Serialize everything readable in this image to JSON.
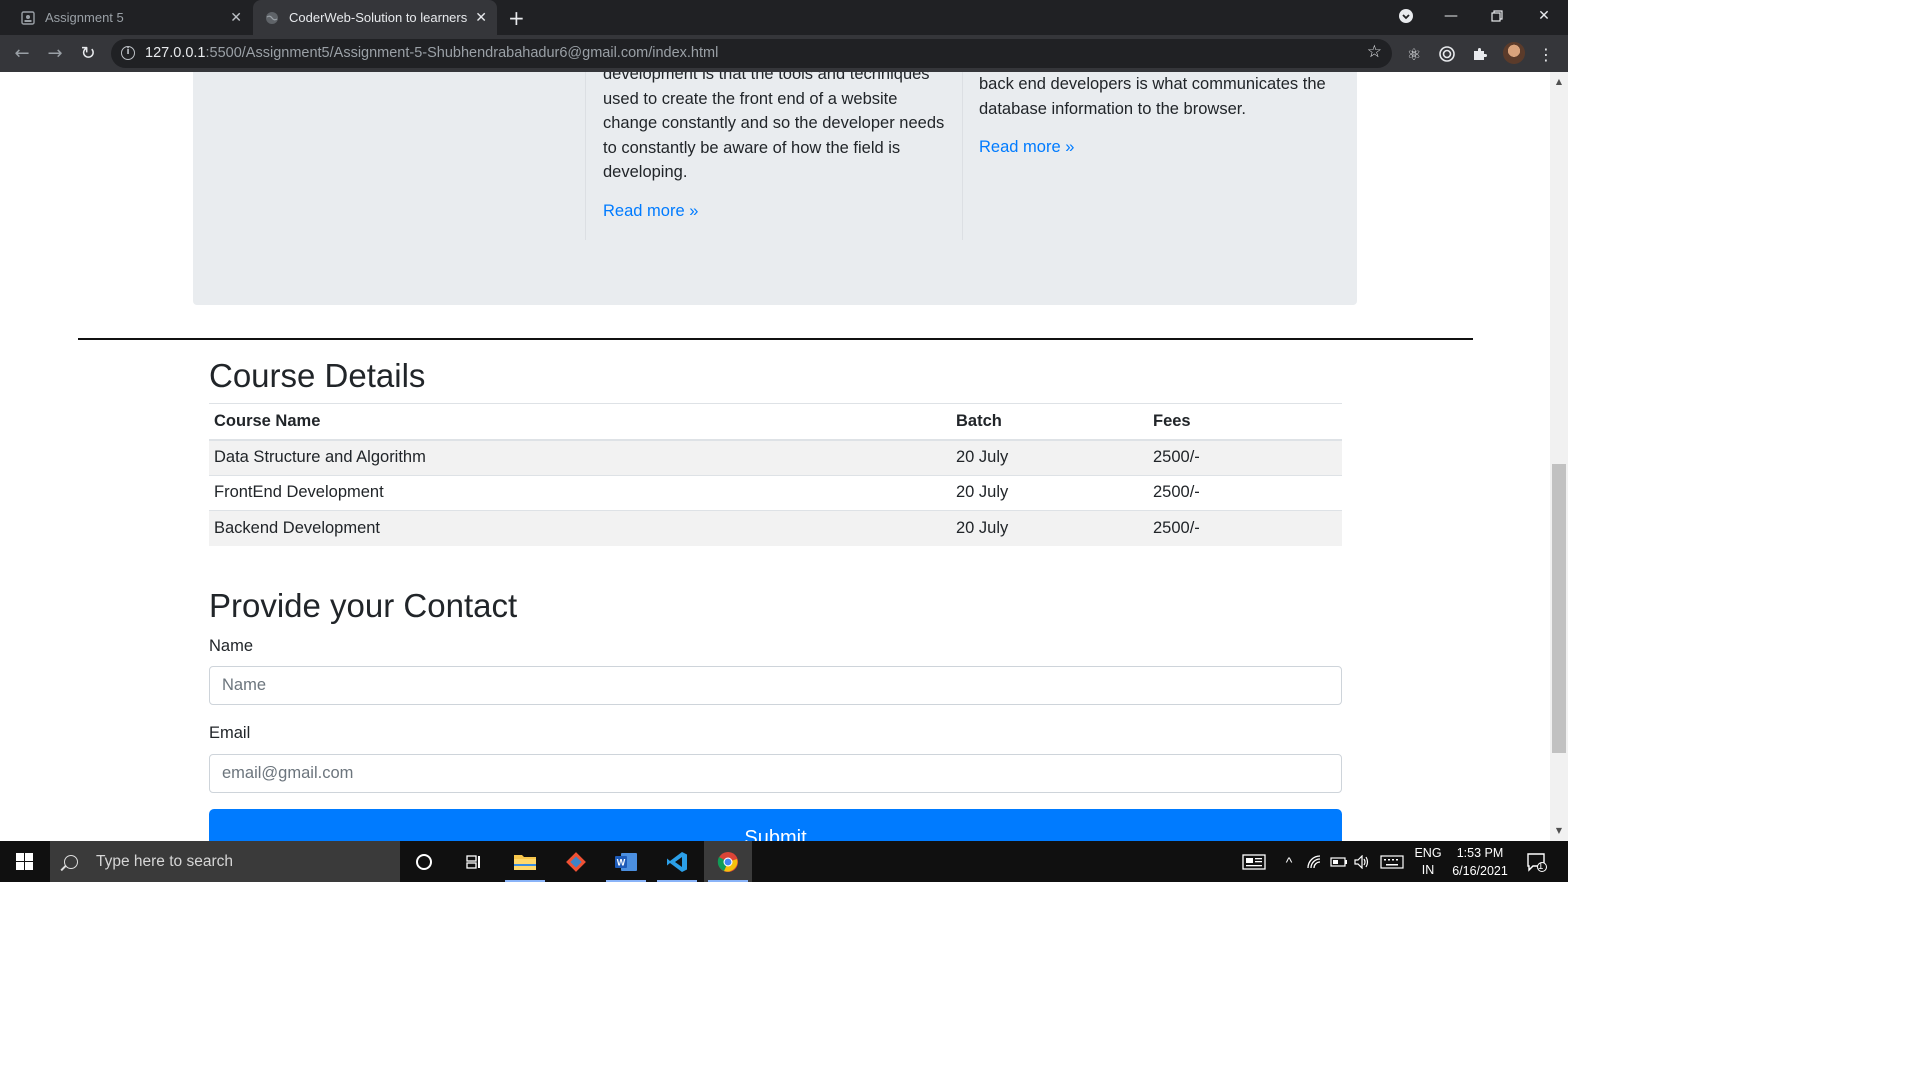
{
  "browser": {
    "tabs": [
      {
        "title": "Assignment 5",
        "active": false,
        "icon": "page-icon"
      },
      {
        "title": "CoderWeb-Solution to learners",
        "active": true,
        "icon": "globe-icon"
      }
    ],
    "url_host": "127.0.0.1",
    "url_rest": ":5500/Assignment5/Assignment-5-Shubhendrabahadur6@gmail.com/index.html"
  },
  "jumbotron": {
    "col2_text": "development is that the tools and techniques used to create the front end of a website change constantly and so the developer needs to constantly be aware of how the field is developing.",
    "col2_lines": [
      "development is that the tools and techniques",
      "used to create the front end of a website",
      "change constantly and so the developer needs",
      "to constantly be aware of how the field is",
      "developing."
    ],
    "col3_lines": [
      "back end developers is what communicates the",
      "database information to the browser."
    ],
    "read_more": "Read more »"
  },
  "course": {
    "title": "Course Details",
    "headers": [
      "Course Name",
      "Batch",
      "Fees"
    ],
    "rows": [
      [
        "Data Structure and Algorithm",
        "20 July",
        "2500/-"
      ],
      [
        "FrontEnd Development",
        "20 July",
        "2500/-"
      ],
      [
        "Backend Development",
        "20 July",
        "2500/-"
      ]
    ]
  },
  "contact": {
    "title": "Provide your Contact",
    "name_label": "Name",
    "name_placeholder": "Name",
    "email_label": "Email",
    "email_placeholder": "email@gmail.com",
    "submit_label": "Submit"
  },
  "taskbar": {
    "search_placeholder": "Type here to search",
    "lang_top": "ENG",
    "lang_bottom": "IN",
    "time": "1:53 PM",
    "date": "6/16/2021",
    "notification_count": "1"
  },
  "colors": {
    "link": "#007bff",
    "button": "#007bff",
    "jumbotron_bg": "#e9ecef",
    "chrome_dark": "#202124",
    "chrome_toolbar": "#35363a"
  }
}
